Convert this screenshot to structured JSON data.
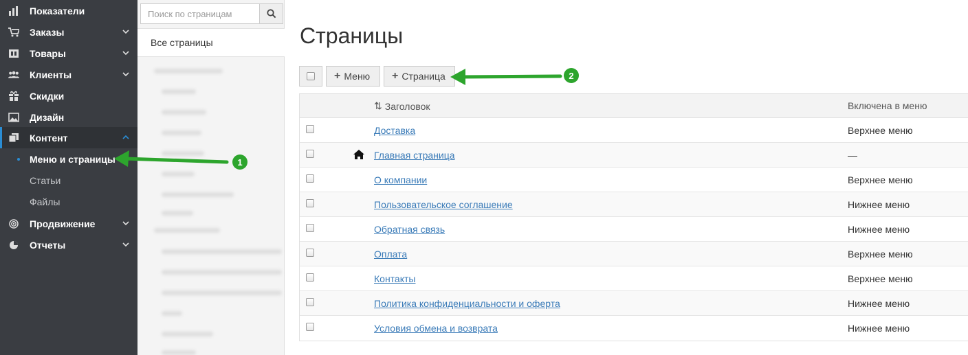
{
  "nav": {
    "items": [
      {
        "label": "Показатели",
        "icon": "bar-chart-icon",
        "chevron": false
      },
      {
        "label": "Заказы",
        "icon": "cart-icon",
        "chevron": true
      },
      {
        "label": "Товары",
        "icon": "box-icon",
        "chevron": true
      },
      {
        "label": "Клиенты",
        "icon": "users-icon",
        "chevron": true
      },
      {
        "label": "Скидки",
        "icon": "gift-icon",
        "chevron": false
      },
      {
        "label": "Дизайн",
        "icon": "image-icon",
        "chevron": false
      },
      {
        "label": "Контент",
        "icon": "copy-icon",
        "chevron": true,
        "active": true
      },
      {
        "label": "Продвижение",
        "icon": "target-icon",
        "chevron": true
      },
      {
        "label": "Отчеты",
        "icon": "pie-chart-icon",
        "chevron": true
      }
    ],
    "subitems": [
      {
        "label": "Меню и страницы",
        "current": true
      },
      {
        "label": "Статьи"
      },
      {
        "label": "Файлы"
      }
    ]
  },
  "sidebar": {
    "search_placeholder": "Поиск по страницам",
    "all_pages": "Все страницы"
  },
  "main": {
    "title": "Страницы",
    "toolbar": {
      "menu_btn": "Меню",
      "page_btn": "Страница"
    },
    "table": {
      "col_title": "Заголовок",
      "col_menu": "Включена в меню",
      "rows": [
        {
          "title": "Доставка",
          "menu": "Верхнее меню"
        },
        {
          "title": "Главная страница",
          "menu": "—",
          "home": true
        },
        {
          "title": "О компании",
          "menu": "Верхнее меню"
        },
        {
          "title": "Пользовательское соглашение",
          "menu": "Нижнее меню"
        },
        {
          "title": "Обратная связь",
          "menu": "Нижнее меню"
        },
        {
          "title": "Оплата",
          "menu": "Верхнее меню"
        },
        {
          "title": "Контакты",
          "menu": "Верхнее меню"
        },
        {
          "title": "Политика конфиденциальности и оферта",
          "menu": "Нижнее меню"
        },
        {
          "title": "Условия обмена и возврата",
          "menu": "Нижнее меню"
        }
      ]
    }
  },
  "annotations": {
    "badge1": "1",
    "badge2": "2",
    "arrow_color": "#2da52d"
  },
  "colors": {
    "nav_bg": "#3a3d42",
    "accent": "#2a8dd4",
    "link": "#3a7bb8"
  }
}
